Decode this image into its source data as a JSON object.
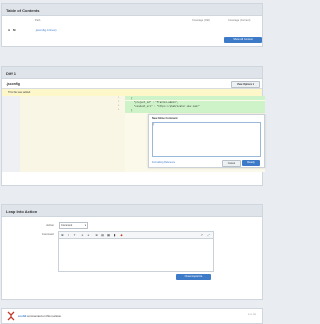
{
  "toc": {
    "title": "Table of Contents",
    "columns": {
      "path": "Path",
      "coverage_old": "Coverage (Old)",
      "coverage_new": "Coverage (Current)"
    },
    "row": {
      "status": "A",
      "mark": "M",
      "file": ".jsconfig.4 lines)"
    },
    "show_all_button": "Show All Context"
  },
  "diff": {
    "title": "Diff 1",
    "file": ".jsconfig",
    "view_options": "View Options ▾",
    "notice": "This file was added.",
    "lines": [
      {
        "num": "1",
        "text": "{"
      },
      {
        "num": "2",
        "text": "  \"project_id\" : \"fractal-admin\","
      },
      {
        "num": "3",
        "text": "  \"conduit_uri\" : \"https://phabricator.dev.com/\""
      },
      {
        "num": "4",
        "text": "}"
      }
    ],
    "comment_form": {
      "title": "New Inline Comment",
      "text_value": "|",
      "formatting_link": "Formatting Reference",
      "cancel": "Cancel",
      "ready": "Ready"
    }
  },
  "leap": {
    "title": "Leap Into Action",
    "action_label": "Action",
    "action_value": "Comment",
    "comment_label": "Comment",
    "toolbar": [
      "B",
      "I",
      "T",
      "≡",
      "≡",
      "⊕",
      "▤",
      "▦",
      "▮",
      "◆",
      "↗",
      "⤢"
    ],
    "submit": "Clowncopterize"
  },
  "feed": {
    "user": "zoofdi",
    "action": " commented on this revision.",
    "timestamp": "3:51 PM"
  },
  "colors": {
    "accent": "#3d7bc8",
    "added": "#cef3c8",
    "notice": "#fdf7c9"
  }
}
